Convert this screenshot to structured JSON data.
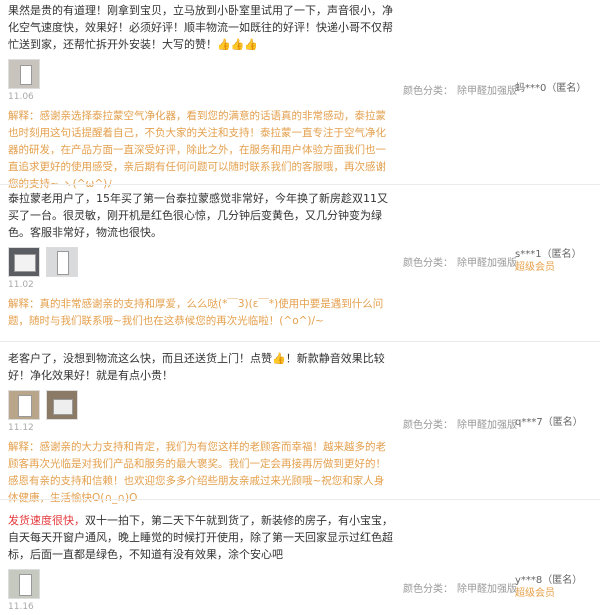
{
  "reviews": [
    {
      "text": "果然是贵的有道理！刚拿到宝贝，立马放到小卧室里试用了一下，声音很小，净化空气速度快，效果好！必须好评！顺丰物流一如既往的好评！快递小哥不仅帮忙送到家，还帮忙拆开外安装！大写的赞！👍👍👍",
      "date": "11.06",
      "reply_label": "解释：",
      "reply": "感谢亲选择泰拉蒙空气净化器，看到您的满意的话语真的非常感动，泰拉蒙也时刻用这句话提醒着自己，不负大家的关注和支持！泰拉蒙一直专注于空气净化器的研发，在产品方面一直深受好评，除此之外，在服务和用户体验方面我们也一直追求更好的使用感受，亲后期有任何问题可以随时联系我们的客服哦，再次感谢您的支持~ ヽ(^ω^)ﾉ",
      "sku_key": "颜色分类：",
      "sku_value": "除甲醛加强版",
      "user": "蚂***0（匿名）",
      "member": ""
    },
    {
      "text": "泰拉蒙老用户了，15年买了第一台泰拉蒙感觉非常好，今年换了新房趁双11又买了一台。很灵敏，刚开机是红色很心惊，几分钟后变黄色，又几分钟变为绿色。客服非常好，物流也很快。",
      "date": "11.02",
      "reply_label": "解释：",
      "reply": "真的非常感谢亲的支持和厚爱，么么哒(*￣3)(ε￣*)使用中要是遇到什么问题，随时与我们联系哦~我们也在这恭候您的再次光临啦！(^o^)/~",
      "sku_key": "颜色分类：",
      "sku_value": "除甲醛加强版",
      "user": "s***1（匿名）",
      "member": "超级会员"
    },
    {
      "text": "老客户了，没想到物流这么快，而且还送货上门！点赞👍！新款静音效果比较好！净化效果好！就是有点小贵！",
      "date": "11.12",
      "reply_label": "解释：",
      "reply": "感谢亲的大力支持和肯定，我们为有您这样的老顾客而幸福！越来越多的老顾客再次光临是对我们产品和服务的最大褒奖。我们一定会再接再厉做到更好的！感恩有亲的支持和信赖！也欢迎您多多介绍些朋友亲戚过来光顾哦~祝您和家人身体健康，生活愉快O(∩_∩)O",
      "sku_key": "颜色分类：",
      "sku_value": "除甲醛加强版",
      "user": "q***7（匿名）",
      "member": ""
    },
    {
      "tag": "发货速度很快，",
      "text": "双十一拍下，第二天下午就到货了，新装修的房子，有小宝宝，自天每天开窗户通风，晚上睡觉的时候打开使用，除了第一天回家显示过红色超标，后面一直都是绿色，不知道有没有效果，涂个安心吧",
      "date": "11.16",
      "sku_key": "颜色分类：",
      "sku_value": "除甲醛加强版",
      "user": "y***8（匿名）",
      "member": "超级会员"
    }
  ],
  "colors": {
    "reply": "#e4a04e",
    "tag": "#e4393c",
    "member": "#e7a24b",
    "date": "#aaaaaa"
  },
  "icons": [
    "product-photo",
    "thumbs-up-icon"
  ]
}
